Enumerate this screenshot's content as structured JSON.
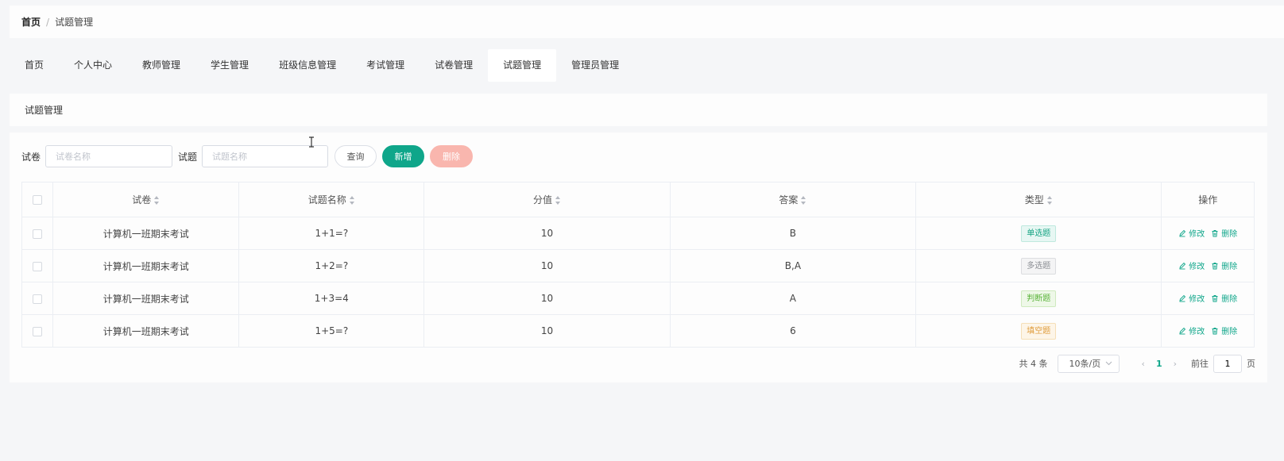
{
  "breadcrumb": {
    "home": "首页",
    "separator": "/",
    "current": "试题管理"
  },
  "nav": {
    "items": [
      "首页",
      "个人中心",
      "教师管理",
      "学生管理",
      "班级信息管理",
      "考试管理",
      "试卷管理",
      "试题管理",
      "管理员管理"
    ],
    "active": "试题管理"
  },
  "page_title": "试题管理",
  "search": {
    "paper_label": "试卷",
    "paper_placeholder": "试卷名称",
    "question_label": "试题",
    "question_placeholder": "试题名称",
    "query_button": "查询",
    "add_button": "新增",
    "delete_button": "删除"
  },
  "table": {
    "headers": [
      "试卷",
      "试题名称",
      "分值",
      "答案",
      "类型",
      "操作"
    ],
    "rows": [
      {
        "paper": "计算机一班期末考试",
        "question": "1+1=?",
        "score": "10",
        "answer": "B",
        "type": "单选题"
      },
      {
        "paper": "计算机一班期末考试",
        "question": "1+2=?",
        "score": "10",
        "answer": "B,A",
        "type": "多选题"
      },
      {
        "paper": "计算机一班期末考试",
        "question": "1+3=4",
        "score": "10",
        "answer": "A",
        "type": "判断题"
      },
      {
        "paper": "计算机一班期末考试",
        "question": "1+5=?",
        "score": "10",
        "answer": "6",
        "type": "填空题"
      }
    ],
    "edit_label": "修改",
    "delete_label": "删除"
  },
  "tag_colors": {
    "单选题": {
      "bg": "#e7f7f3",
      "border": "#bfe9de",
      "text": "#14a382"
    },
    "多选题": {
      "bg": "#f4f4f5",
      "border": "#dcdde0",
      "text": "#8a8d93"
    },
    "判断题": {
      "bg": "#eef8e8",
      "border": "#cfeabf",
      "text": "#58b237"
    },
    "填空题": {
      "bg": "#fdf5e8",
      "border": "#f5dfb8",
      "text": "#df9c3b"
    }
  },
  "pagination": {
    "total_text": "共 4 条",
    "page_size": "10条/页",
    "current_page": "1",
    "goto_label": "前往",
    "goto_value": "1",
    "page_suffix": "页"
  },
  "colors": {
    "accent": "#0fa68a",
    "danger_light": "#f9b6ae"
  }
}
